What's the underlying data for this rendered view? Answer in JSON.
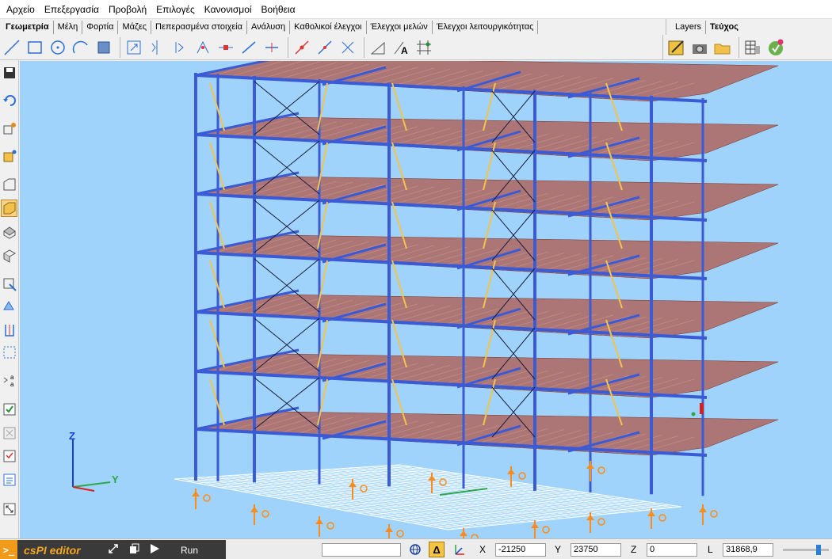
{
  "menu": [
    "Αρχείο",
    "Επεξεργασία",
    "Προβολή",
    "Επιλογές",
    "Κανονισμοί",
    "Βοήθεια"
  ],
  "tabs": [
    "Γεωμετρία",
    "Μέλη",
    "Φορτία",
    "Μάζες",
    "Πεπερασμένα στοιχεία",
    "Ανάλυση",
    "Καθολικοί έλεγχοι",
    "Έλεγχοι μελών",
    "Έλεγχοι λειτουργικότητας"
  ],
  "right_tabs": [
    "Layers",
    "Τεύχος"
  ],
  "axes": {
    "z": "Z",
    "y": "Y"
  },
  "editor": {
    "prompt": ">_",
    "title": "csPI editor",
    "run_label": "Run"
  },
  "status": {
    "command_value": "",
    "x_label": "X",
    "x_value": "-21250",
    "y_label": "Y",
    "y_value": "23750",
    "z_label": "Z",
    "z_value": "0",
    "l_label": "L",
    "l_value": "31868,9"
  },
  "colors": {
    "viewport": "#9fd3fb",
    "beam": "#3b5ad6",
    "slab": "#b0574a",
    "brace_yellow": "#f4c34a",
    "support": "#ff8c1a"
  }
}
